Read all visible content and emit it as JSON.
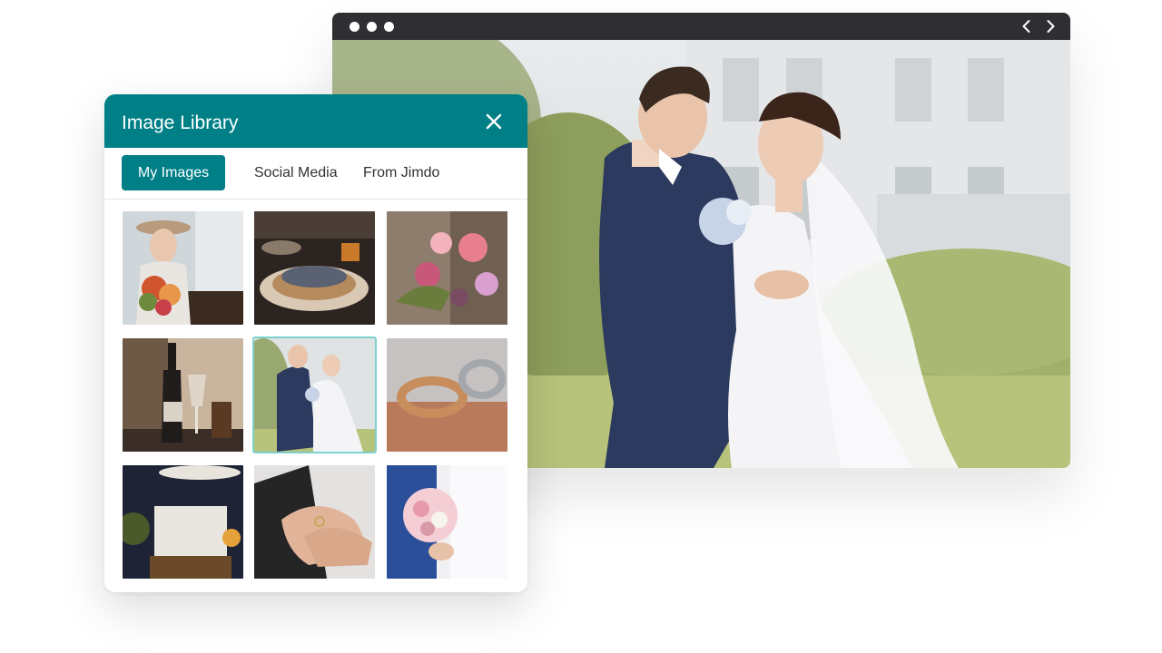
{
  "browser": {
    "controls": {
      "window_dots": [
        "window-dot",
        "window-dot",
        "window-dot"
      ],
      "back_icon": "chevron-left-icon",
      "forward_icon": "chevron-right-icon"
    },
    "hero_image": "wedding-couple-photo"
  },
  "panel": {
    "title": "Image Library",
    "close_icon": "close-icon",
    "tabs": [
      {
        "label": "My Images",
        "active": true
      },
      {
        "label": "Social Media",
        "active": false
      },
      {
        "label": "From Jimdo",
        "active": false
      }
    ],
    "thumbnails": [
      {
        "subject": "bride-with-hat-bouquet",
        "selected": false
      },
      {
        "subject": "table-setting",
        "selected": false
      },
      {
        "subject": "flower-bouquet",
        "selected": false
      },
      {
        "subject": "wine-bottle-glasses",
        "selected": false
      },
      {
        "subject": "wedding-couple",
        "selected": true
      },
      {
        "subject": "wedding-rings",
        "selected": false
      },
      {
        "subject": "outdoor-chairs-night",
        "selected": false
      },
      {
        "subject": "hands-with-ring",
        "selected": false
      },
      {
        "subject": "bride-bouquet-closeup",
        "selected": false
      }
    ]
  },
  "colors": {
    "accent": "#007f86",
    "browser_bar": "#2f2f33",
    "selected_outline": "#7fd1cf"
  }
}
